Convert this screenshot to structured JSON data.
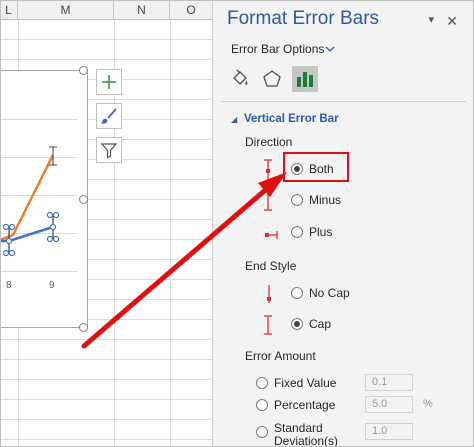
{
  "sheet": {
    "columns": [
      "L",
      "M",
      "N",
      "O"
    ],
    "x_axis_labels": [
      "8",
      "9"
    ],
    "chart_buttons": [
      {
        "name": "chart-elements-button",
        "icon": "plus-icon"
      },
      {
        "name": "chart-styles-button",
        "icon": "brush-icon"
      },
      {
        "name": "chart-filters-button",
        "icon": "filter-icon"
      }
    ]
  },
  "pane": {
    "title": "Format Error Bars",
    "close_glyph": "✕",
    "menu_glyph": "▾",
    "options_tab": "Error Bar Options",
    "tabs": [
      {
        "name": "fill-line-tab",
        "icon": "paint-bucket-icon"
      },
      {
        "name": "effects-tab",
        "icon": "pentagon-icon"
      },
      {
        "name": "error-bar-options-tab",
        "icon": "bar-chart-icon"
      }
    ],
    "section": "Vertical Error Bar",
    "direction_label": "Direction",
    "direction_options": [
      {
        "label": "Both",
        "checked": true
      },
      {
        "label": "Minus",
        "checked": false
      },
      {
        "label": "Plus",
        "checked": false
      }
    ],
    "end_style_label": "End Style",
    "end_style_options": [
      {
        "label": "No Cap",
        "checked": false
      },
      {
        "label": "Cap",
        "checked": true
      }
    ],
    "error_amount_label": "Error Amount",
    "error_amount_options": [
      {
        "label": "Fixed Value",
        "value": "0.1",
        "unit": ""
      },
      {
        "label": "Percentage",
        "value": "5.0",
        "unit": "%"
      },
      {
        "label": "Standard Deviation(s)",
        "value": "1.0",
        "unit": ""
      }
    ]
  },
  "colors": {
    "accent": "#2c5aa0",
    "series_orange": "#ed7d31",
    "series_blue": "#4472c4",
    "highlight_red": "#e01010"
  }
}
